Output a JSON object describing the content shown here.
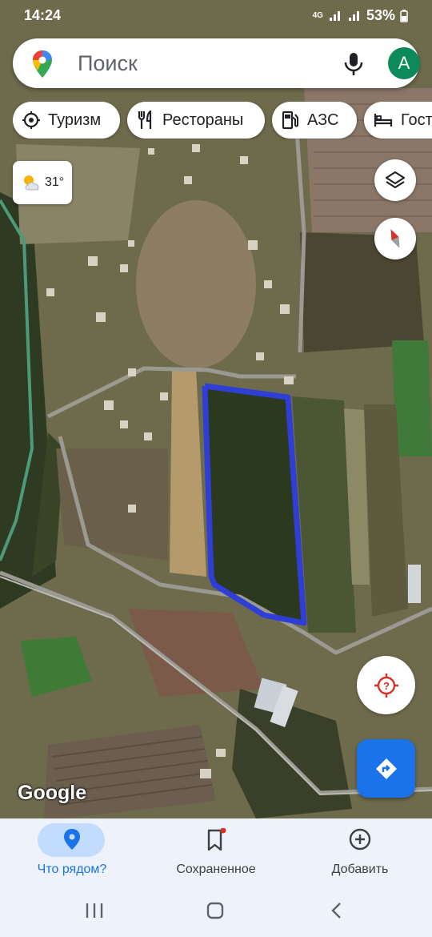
{
  "status_bar": {
    "time": "14:24",
    "network": "4G",
    "battery": "53%"
  },
  "search": {
    "placeholder": "Поиск",
    "avatar_letter": "A"
  },
  "chips": [
    {
      "label": "Туризм",
      "icon": "tourism-icon"
    },
    {
      "label": "Рестораны",
      "icon": "restaurant-icon"
    },
    {
      "label": "АЗС",
      "icon": "gas-station-icon"
    },
    {
      "label": "Гост",
      "icon": "hotel-icon"
    }
  ],
  "weather": {
    "temp": "31°",
    "icon": "partly-cloudy-icon"
  },
  "map": {
    "attribution": "Google",
    "outline_color": "#2f3fd6"
  },
  "bottom_nav": {
    "items": [
      {
        "label": "Что рядом?",
        "icon": "location-pin-icon",
        "active": true
      },
      {
        "label": "Сохраненное",
        "icon": "bookmark-icon",
        "active": false,
        "badge": true
      },
      {
        "label": "Добавить",
        "icon": "add-circle-icon",
        "active": false
      }
    ]
  },
  "colors": {
    "accent": "#1a73e8",
    "active_pill": "#c2dbff",
    "nav_bg": "#eef3fb"
  }
}
